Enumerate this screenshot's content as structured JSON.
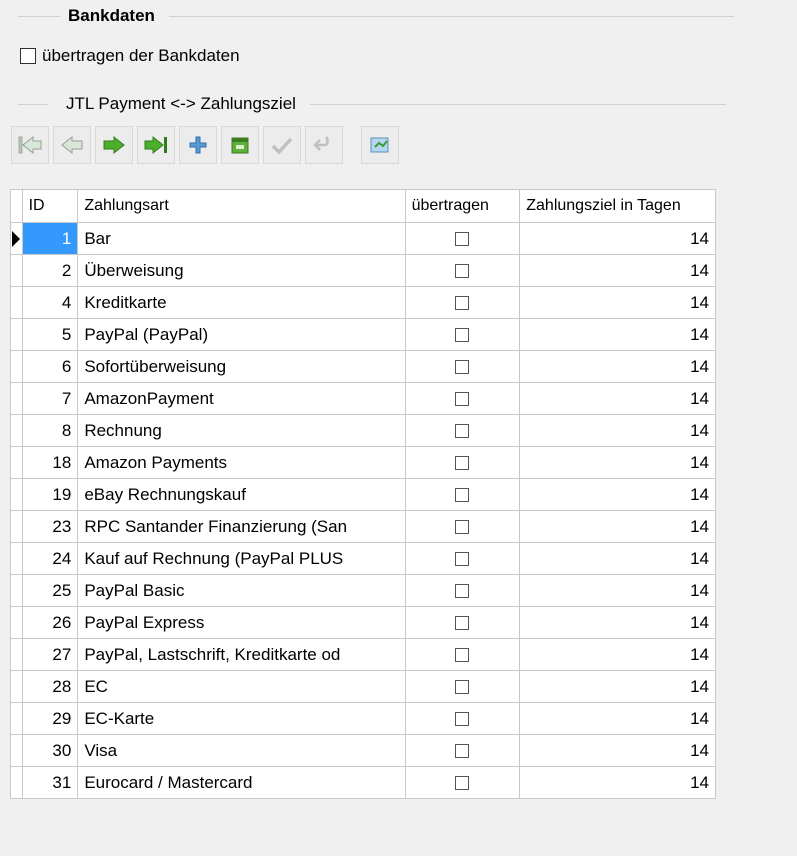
{
  "bank_group": {
    "title": "Bankdaten",
    "checkbox_label": "übertragen der Bankdaten"
  },
  "jtl_group": {
    "title": "JTL Payment <-> Zahlungsziel"
  },
  "toolbar": {
    "buttons": [
      "first-record-icon",
      "previous-record-icon",
      "next-record-icon",
      "last-record-icon",
      "add-record-icon",
      "delete-record-icon",
      "post-record-icon",
      "cancel-record-icon",
      "refresh-icon"
    ]
  },
  "grid": {
    "headers": {
      "id": "ID",
      "name": "Zahlungsart",
      "transfer": "übertragen",
      "days": "Zahlungsziel in Tagen"
    },
    "rows": [
      {
        "id": "1",
        "name": "Bar",
        "days": "14"
      },
      {
        "id": "2",
        "name": "Überweisung",
        "days": "14"
      },
      {
        "id": "4",
        "name": "Kreditkarte",
        "days": "14"
      },
      {
        "id": "5",
        "name": "PayPal (PayPal)",
        "days": "14"
      },
      {
        "id": "6",
        "name": "Sofortüberweisung",
        "days": "14"
      },
      {
        "id": "7",
        "name": "AmazonPayment",
        "days": "14"
      },
      {
        "id": "8",
        "name": "Rechnung",
        "days": "14"
      },
      {
        "id": "18",
        "name": "Amazon Payments",
        "days": "14"
      },
      {
        "id": "19",
        "name": "eBay Rechnungskauf",
        "days": "14"
      },
      {
        "id": "23",
        "name": "RPC Santander Finanzierung (San",
        "days": "14"
      },
      {
        "id": "24",
        "name": "Kauf auf Rechnung (PayPal PLUS",
        "days": "14"
      },
      {
        "id": "25",
        "name": "PayPal Basic",
        "days": "14"
      },
      {
        "id": "26",
        "name": "PayPal Express",
        "days": "14"
      },
      {
        "id": "27",
        "name": "PayPal, Lastschrift, Kreditkarte od",
        "days": "14"
      },
      {
        "id": "28",
        "name": "EC",
        "days": "14"
      },
      {
        "id": "29",
        "name": "EC-Karte",
        "days": "14"
      },
      {
        "id": "30",
        "name": "Visa",
        "days": "14"
      },
      {
        "id": "31",
        "name": "Eurocard / Mastercard",
        "days": "14"
      }
    ]
  }
}
